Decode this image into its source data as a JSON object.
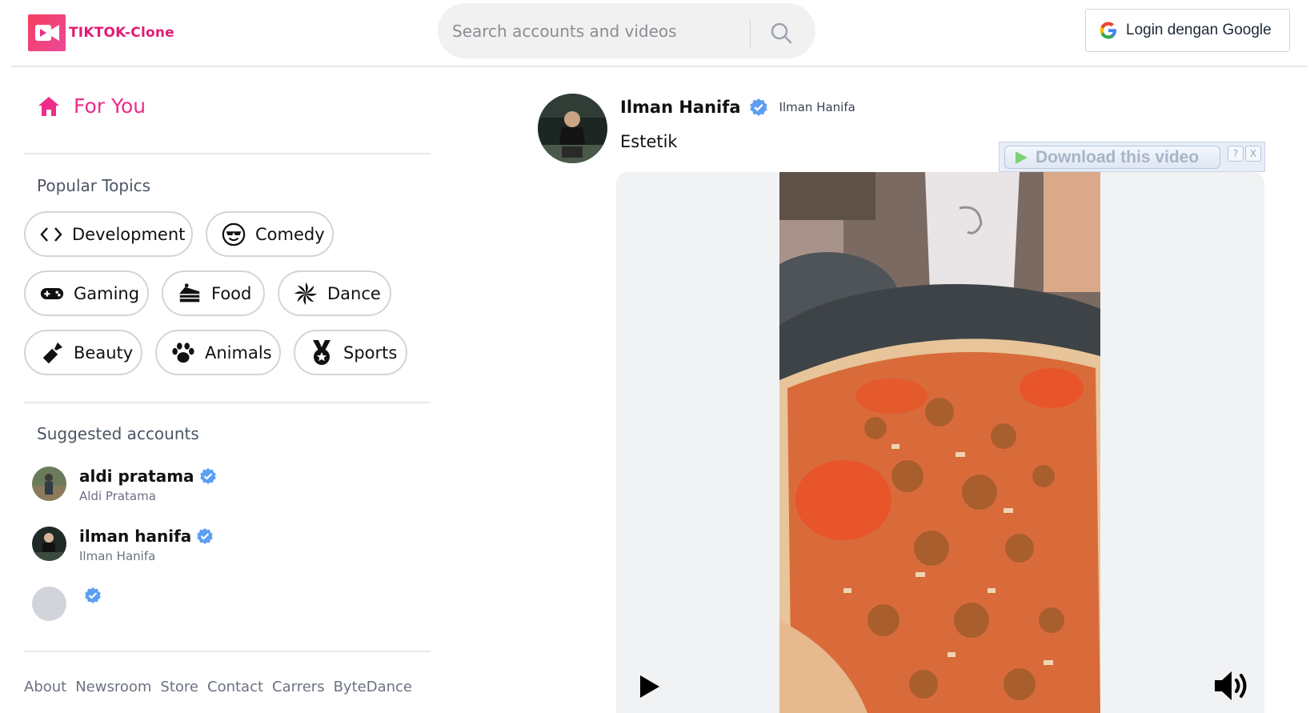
{
  "header": {
    "logo_text": "TIKTOK-Clone",
    "search_placeholder": "Search accounts and videos",
    "login_label": "Login dengan Google"
  },
  "sidebar": {
    "for_you_label": "For You",
    "popular_topics_title": "Popular Topics",
    "topics": [
      {
        "label": "Development",
        "icon": "code-icon"
      },
      {
        "label": "Comedy",
        "icon": "sunglasses-face-icon"
      },
      {
        "label": "Gaming",
        "icon": "gamepad-icon"
      },
      {
        "label": "Food",
        "icon": "cake-slice-icon"
      },
      {
        "label": "Dance",
        "icon": "spiral-icon"
      },
      {
        "label": "Beauty",
        "icon": "lipstick-icon"
      },
      {
        "label": "Animals",
        "icon": "paw-icon"
      },
      {
        "label": "Sports",
        "icon": "medal-icon"
      }
    ],
    "suggested_title": "Suggested accounts",
    "accounts": [
      {
        "name": "aldi pratama",
        "handle": "Aldi Pratama"
      },
      {
        "name": "ilman hanifa",
        "handle": "Ilman Hanifa"
      },
      {
        "name": "",
        "handle": ""
      }
    ],
    "footer_links": [
      "About",
      "Newsroom",
      "Store",
      "Contact",
      "Carrers",
      "ByteDance"
    ]
  },
  "post": {
    "author_name": "Ilman Hanifa",
    "author_handle": "Ilman Hanifa",
    "caption": "Estetik",
    "download_label": "Download this video",
    "help_label": "?",
    "close_label": "X"
  },
  "colors": {
    "brand_pink": "#ec2d8b",
    "verified_blue": "#5b9ef4"
  }
}
